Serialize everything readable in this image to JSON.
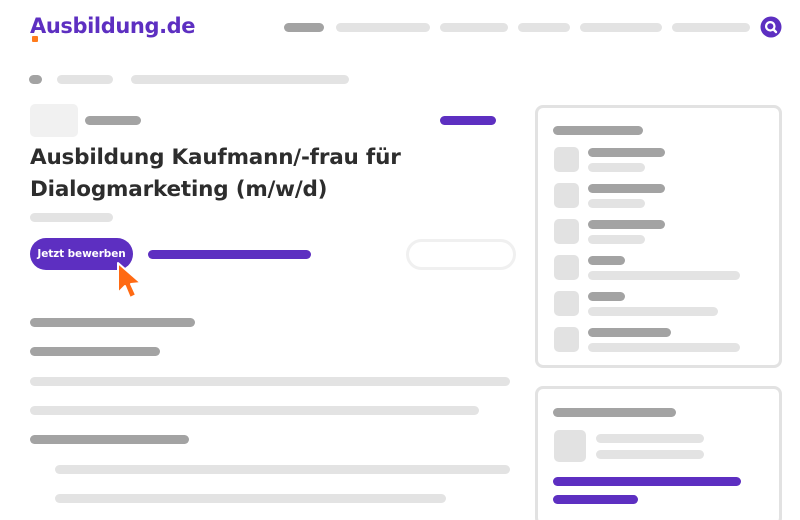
{
  "header": {
    "logo_text": "Ausbildung.de",
    "search_icon": "search-icon"
  },
  "job": {
    "title": "Ausbildung Kaufmann/-frau für Dialogmarketing (m/w/d)",
    "apply_label": "Jetzt bewerben"
  },
  "icons": {
    "cursor": "mouse-pointer-icon"
  },
  "colors": {
    "brand": "#5d2fc1",
    "accent": "#ff7b1c",
    "placeholder": "#c9c9c9"
  }
}
